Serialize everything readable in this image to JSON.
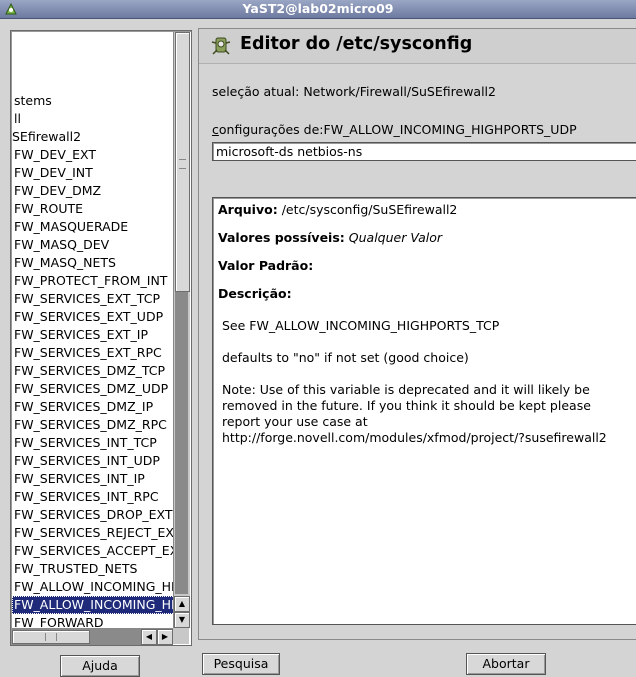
{
  "window": {
    "title": "YaST2@lab02micro09",
    "icon": "yast-icon"
  },
  "tree": {
    "items": [
      {
        "label": "stems"
      },
      {
        "label": "ll"
      },
      {
        "label": "SEfirewall2"
      },
      {
        "label": "FW_DEV_EXT"
      },
      {
        "label": "FW_DEV_INT"
      },
      {
        "label": "FW_DEV_DMZ"
      },
      {
        "label": "FW_ROUTE"
      },
      {
        "label": "FW_MASQUERADE"
      },
      {
        "label": "FW_MASQ_DEV"
      },
      {
        "label": "FW_MASQ_NETS"
      },
      {
        "label": "FW_PROTECT_FROM_INT"
      },
      {
        "label": "FW_SERVICES_EXT_TCP"
      },
      {
        "label": "FW_SERVICES_EXT_UDP"
      },
      {
        "label": "FW_SERVICES_EXT_IP"
      },
      {
        "label": "FW_SERVICES_EXT_RPC"
      },
      {
        "label": "FW_SERVICES_DMZ_TCP"
      },
      {
        "label": "FW_SERVICES_DMZ_UDP"
      },
      {
        "label": "FW_SERVICES_DMZ_IP"
      },
      {
        "label": "FW_SERVICES_DMZ_RPC"
      },
      {
        "label": "FW_SERVICES_INT_TCP"
      },
      {
        "label": "FW_SERVICES_INT_UDP"
      },
      {
        "label": "FW_SERVICES_INT_IP"
      },
      {
        "label": "FW_SERVICES_INT_RPC"
      },
      {
        "label": "FW_SERVICES_DROP_EXT"
      },
      {
        "label": "FW_SERVICES_REJECT_EXT"
      },
      {
        "label": "FW_SERVICES_ACCEPT_EXT"
      },
      {
        "label": "FW_TRUSTED_NETS"
      },
      {
        "label": "FW_ALLOW_INCOMING_HIGHPORTS_TCP"
      },
      {
        "label": "FW_ALLOW_INCOMING_HIGHPORTS_UDP"
      },
      {
        "label": "FW_FORWARD"
      }
    ],
    "selected_index": 28
  },
  "editor": {
    "title": "Editor do /etc/sysconfig",
    "current_selection": "seleção atual: Network/Firewall/SuSEfirewall2",
    "config_label_mnemonic": "c",
    "config_label_rest": "onfigurações de:FW_ALLOW_INCOMING_HIGHPORTS_UDP",
    "config_value": "microsoft-ds netbios-ns"
  },
  "info": {
    "file_label": "Arquivo:",
    "file_value": "/etc/sysconfig/SuSEfirewall2",
    "possible_label": "Valores possíveis:",
    "possible_value": "Qualquer Valor",
    "default_label": "Valor Padrão:",
    "description_label": "Descrição:",
    "desc_line1": "See FW_ALLOW_INCOMING_HIGHPORTS_TCP",
    "desc_line2": "defaults to \"no\" if not set (good choice)",
    "desc_line3": "Note: Use of this variable is deprecated and it will likely be",
    "desc_line4": "removed in the future. If you think it should be kept please",
    "desc_line5": "report your use case at",
    "desc_line6": "http://forge.novell.com/modules/xfmod/project/?susefirewall2"
  },
  "buttons": {
    "help": "Ajuda",
    "search": "Pesquisa",
    "abort": "Abortar"
  }
}
